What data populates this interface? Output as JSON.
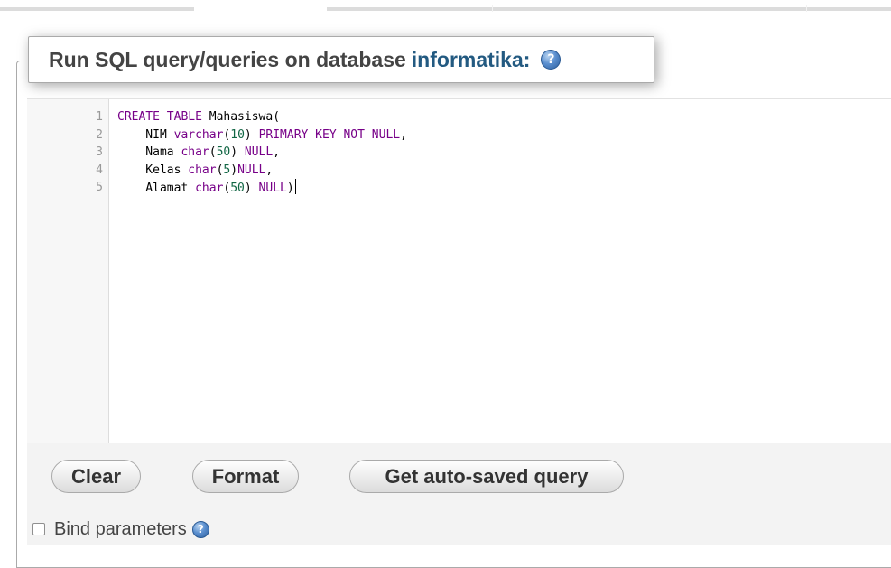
{
  "legend": {
    "title": "Run SQL query/queries on database",
    "database": "informatika:",
    "help_icon": "?"
  },
  "editor": {
    "lines": [
      {
        "num": "1",
        "tokens": [
          {
            "t": "CREATE TABLE",
            "c": "kw"
          },
          {
            "t": " Mahasiswa(",
            "c": "at"
          }
        ]
      },
      {
        "num": "2",
        "tokens": [
          {
            "t": "    NIM ",
            "c": "at"
          },
          {
            "t": "varchar",
            "c": "vr"
          },
          {
            "t": "(",
            "c": "at"
          },
          {
            "t": "10",
            "c": "nu"
          },
          {
            "t": ") ",
            "c": "at"
          },
          {
            "t": "PRIMARY KEY NOT NULL",
            "c": "kw"
          },
          {
            "t": ",",
            "c": "at"
          }
        ]
      },
      {
        "num": "3",
        "tokens": [
          {
            "t": "    Nama ",
            "c": "at"
          },
          {
            "t": "char",
            "c": "vr"
          },
          {
            "t": "(",
            "c": "at"
          },
          {
            "t": "50",
            "c": "nu"
          },
          {
            "t": ") ",
            "c": "at"
          },
          {
            "t": "NULL",
            "c": "kw"
          },
          {
            "t": ",",
            "c": "at"
          }
        ]
      },
      {
        "num": "4",
        "tokens": [
          {
            "t": "    Kelas ",
            "c": "at"
          },
          {
            "t": "char",
            "c": "vr"
          },
          {
            "t": "(",
            "c": "at"
          },
          {
            "t": "5",
            "c": "nu"
          },
          {
            "t": ")",
            "c": "at"
          },
          {
            "t": "NULL",
            "c": "kw"
          },
          {
            "t": ",",
            "c": "at"
          }
        ]
      },
      {
        "num": "5",
        "tokens": [
          {
            "t": "    Alamat ",
            "c": "at"
          },
          {
            "t": "char",
            "c": "vr"
          },
          {
            "t": "(",
            "c": "at"
          },
          {
            "t": "50",
            "c": "nu"
          },
          {
            "t": ") ",
            "c": "at"
          },
          {
            "t": "NULL",
            "c": "kw"
          },
          {
            "t": ")",
            "c": "at"
          }
        ]
      }
    ]
  },
  "buttons": {
    "clear": "Clear",
    "format": "Format",
    "autosaved": "Get auto-saved query"
  },
  "bind_parameters": {
    "label": "Bind parameters",
    "checked": false
  },
  "colors": {
    "keyword": "#770088",
    "number": "#116644",
    "database_name": "#235a81"
  }
}
